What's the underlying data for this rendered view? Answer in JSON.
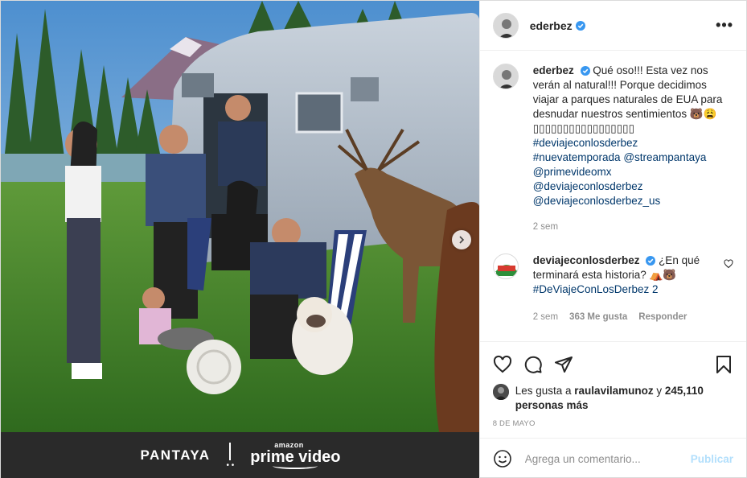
{
  "post": {
    "brand": {
      "pantaya": "PANTAYA",
      "amazon": "amazon",
      "prime": "prime video"
    },
    "header": {
      "username": "ederbez",
      "more_label": "•••"
    },
    "caption": {
      "username": "ederbez",
      "text": "Qué oso!!! Esta vez nos verán al natural!!! Porque decidimos viajar a parques naturales de EUA para desnudar nuestros sentimientos 🐻😩",
      "boxes": "▯▯▯▯▯▯▯▯▯▯▯▯▯▯▯▯▯",
      "tags": [
        "#deviajeconlosderbez",
        "#nuevatemporada",
        "@streampantaya",
        "@primevideomx",
        "@deviajeconlosderbez",
        "@deviajeconlosderbez_us"
      ],
      "time": "2 sem"
    },
    "comment": {
      "username": "deviajeconlosderbez",
      "text": "¿En qué terminará esta historia? ⛺🐻",
      "hashtag": "#DeViajeConLosDerbez 2",
      "time": "2 sem",
      "likes": "363 Me gusta",
      "reply": "Responder"
    },
    "likes": {
      "prefix": "Les gusta a",
      "user": "raulavilamunoz",
      "joiner": "y",
      "others": "245,110 personas más"
    },
    "date": "8 DE MAYO",
    "add_comment": {
      "placeholder": "Agrega un comentario...",
      "publish": "Publicar"
    },
    "colors": {
      "link": "#00376b",
      "verified": "#3897f0",
      "publish_disabled": "#b2dffc"
    }
  }
}
